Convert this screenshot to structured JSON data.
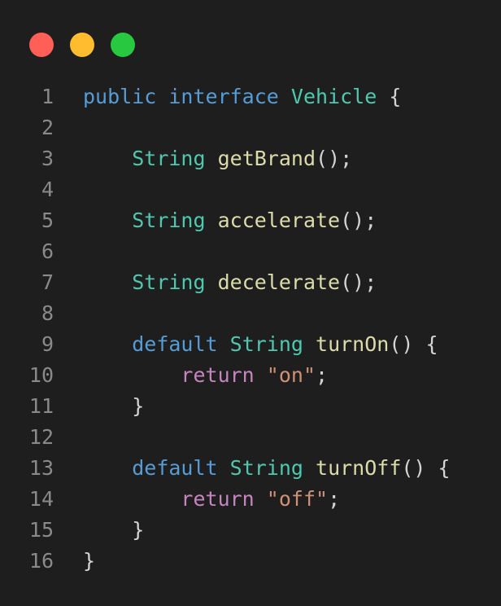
{
  "window_controls": [
    {
      "name": "close-button",
      "color": "#ff5f57"
    },
    {
      "name": "minimize-button",
      "color": "#febc2e"
    },
    {
      "name": "maximize-button",
      "color": "#28c840"
    }
  ],
  "code": {
    "lines": [
      {
        "n": "1",
        "tokens": [
          {
            "t": "public",
            "c": "kw"
          },
          {
            "t": " ",
            "c": "pun"
          },
          {
            "t": "interface",
            "c": "kw"
          },
          {
            "t": " ",
            "c": "pun"
          },
          {
            "t": "Vehicle",
            "c": "type"
          },
          {
            "t": " {",
            "c": "pun"
          }
        ]
      },
      {
        "n": "2",
        "tokens": []
      },
      {
        "n": "3",
        "tokens": [
          {
            "t": "    ",
            "c": "pun"
          },
          {
            "t": "String",
            "c": "type"
          },
          {
            "t": " ",
            "c": "pun"
          },
          {
            "t": "getBrand",
            "c": "fn"
          },
          {
            "t": "();",
            "c": "pun"
          }
        ]
      },
      {
        "n": "4",
        "tokens": []
      },
      {
        "n": "5",
        "tokens": [
          {
            "t": "    ",
            "c": "pun"
          },
          {
            "t": "String",
            "c": "type"
          },
          {
            "t": " ",
            "c": "pun"
          },
          {
            "t": "accelerate",
            "c": "fn"
          },
          {
            "t": "();",
            "c": "pun"
          }
        ]
      },
      {
        "n": "6",
        "tokens": []
      },
      {
        "n": "7",
        "tokens": [
          {
            "t": "    ",
            "c": "pun"
          },
          {
            "t": "String",
            "c": "type"
          },
          {
            "t": " ",
            "c": "pun"
          },
          {
            "t": "decelerate",
            "c": "fn"
          },
          {
            "t": "();",
            "c": "pun"
          }
        ]
      },
      {
        "n": "8",
        "tokens": []
      },
      {
        "n": "9",
        "tokens": [
          {
            "t": "    ",
            "c": "pun"
          },
          {
            "t": "default",
            "c": "kw"
          },
          {
            "t": " ",
            "c": "pun"
          },
          {
            "t": "String",
            "c": "type"
          },
          {
            "t": " ",
            "c": "pun"
          },
          {
            "t": "turnOn",
            "c": "fn"
          },
          {
            "t": "() {",
            "c": "pun"
          }
        ]
      },
      {
        "n": "10",
        "tokens": [
          {
            "t": "        ",
            "c": "pun"
          },
          {
            "t": "return",
            "c": "ctrl"
          },
          {
            "t": " ",
            "c": "pun"
          },
          {
            "t": "\"on\"",
            "c": "str"
          },
          {
            "t": ";",
            "c": "pun"
          }
        ]
      },
      {
        "n": "11",
        "tokens": [
          {
            "t": "    }",
            "c": "pun"
          }
        ]
      },
      {
        "n": "12",
        "tokens": []
      },
      {
        "n": "13",
        "tokens": [
          {
            "t": "    ",
            "c": "pun"
          },
          {
            "t": "default",
            "c": "kw"
          },
          {
            "t": " ",
            "c": "pun"
          },
          {
            "t": "String",
            "c": "type"
          },
          {
            "t": " ",
            "c": "pun"
          },
          {
            "t": "turnOff",
            "c": "fn"
          },
          {
            "t": "() {",
            "c": "pun"
          }
        ]
      },
      {
        "n": "14",
        "tokens": [
          {
            "t": "        ",
            "c": "pun"
          },
          {
            "t": "return",
            "c": "ctrl"
          },
          {
            "t": " ",
            "c": "pun"
          },
          {
            "t": "\"off\"",
            "c": "str"
          },
          {
            "t": ";",
            "c": "pun"
          }
        ]
      },
      {
        "n": "15",
        "tokens": [
          {
            "t": "    }",
            "c": "pun"
          }
        ]
      },
      {
        "n": "16",
        "tokens": [
          {
            "t": "}",
            "c": "pun"
          }
        ]
      }
    ]
  },
  "colors": {
    "background": "#1e1e1e",
    "keyword": "#569cd6",
    "type": "#4ec9b0",
    "function": "#dcdcaa",
    "control": "#c586c0",
    "string": "#ce9178",
    "punctuation": "#d4d4d4",
    "line_number": "#8a8a8a"
  }
}
